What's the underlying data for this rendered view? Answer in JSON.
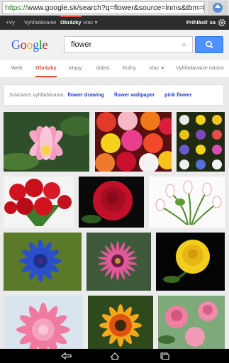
{
  "browser": {
    "url_protocol": "https://",
    "url_rest": "www.google.sk/search?q=flower&source=lnms&tbm=isc"
  },
  "gbar": {
    "items": [
      "+Vy",
      "Vyhľadávanie",
      "Obrázky",
      "Viac"
    ],
    "more_caret": "▾",
    "signin": "Prihlásiť sa"
  },
  "search": {
    "logo": [
      "G",
      "o",
      "o",
      "g",
      "l",
      "e"
    ],
    "query": "flower",
    "clear_symbol": "×"
  },
  "tabs": [
    {
      "label": "Web"
    },
    {
      "label": "Obrázky"
    },
    {
      "label": "Mapy"
    },
    {
      "label": "Videá"
    },
    {
      "label": "Knihy"
    },
    {
      "label": "Viac"
    },
    {
      "label": "Vyhľadávacie nástro"
    }
  ],
  "related": {
    "label": "Súvisiace vyhľadávania:",
    "links": [
      "flower drawing",
      "flower wallpaper",
      "pink flower"
    ]
  },
  "images": [
    "pink lotus flower",
    "roses bouquet",
    "flower grid collage",
    "red roses bouquet",
    "red rose",
    "white tulips",
    "blue cornflower",
    "pink gazania flower",
    "yellow rose",
    "pink dahlia",
    "orange gazania flower",
    "pink roses"
  ],
  "colors": {
    "accent_red": "#dd4b39",
    "link_blue": "#1a3fc9",
    "search_blue": "#4d90fe"
  }
}
